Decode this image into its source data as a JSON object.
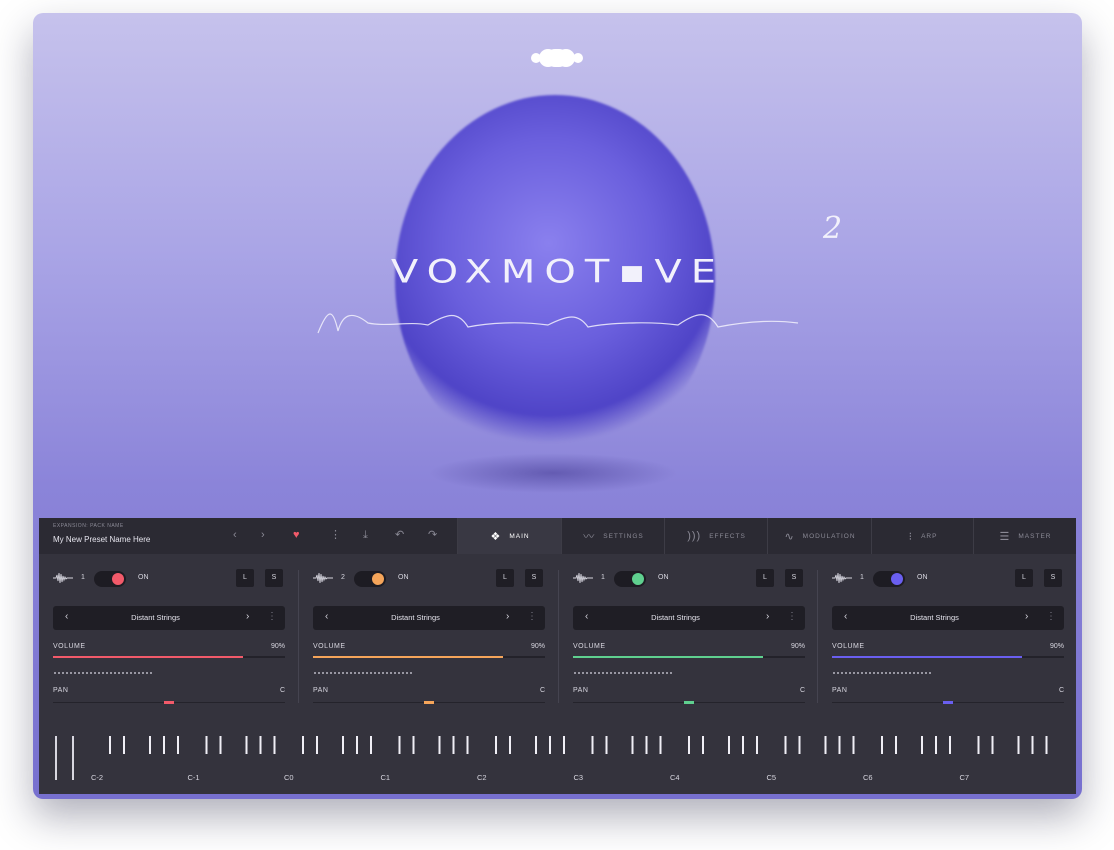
{
  "hero": {
    "product_title": "VOXMOT▪VE",
    "version_mark": "2",
    "subtitle_script": "New Age Cinematic Vocals"
  },
  "colors": {
    "accent_red": "#f25a6a",
    "accent_orange": "#f5a55a",
    "accent_green": "#5fd08f",
    "accent_blue": "#6a5ff0",
    "panel_bg": "#34333d"
  },
  "topbar": {
    "expansion_label": "EXPANSION: PACK NAME",
    "preset_name": "My New Preset  Name Here",
    "icons": [
      "chevron-left-icon",
      "chevron-right-icon",
      "heart-icon",
      "kebab-icon",
      "download-icon",
      "undo-icon",
      "redo-icon"
    ],
    "tabs": [
      {
        "label": "MAIN",
        "icon": "main-diamond-icon",
        "active": true
      },
      {
        "label": "SETTINGS",
        "icon": "waveform-icon",
        "active": false
      },
      {
        "label": "EFFECTS",
        "icon": "effects-icon",
        "active": false
      },
      {
        "label": "MODULATION",
        "icon": "modulation-icon",
        "active": false
      },
      {
        "label": "ARP",
        "icon": "arp-icon",
        "active": false
      },
      {
        "label": "MASTER",
        "icon": "sliders-icon",
        "active": false
      }
    ]
  },
  "channels": [
    {
      "number": "1",
      "on_label": "ON",
      "l_label": "L",
      "s_label": "S",
      "sample": "Distant Strings",
      "volume_label": "VOLUME",
      "volume_value": "90%",
      "volume_fraction": 0.82,
      "pan_label": "PAN",
      "pan_value": "C",
      "color": "#f25a6a"
    },
    {
      "number": "2",
      "on_label": "ON",
      "l_label": "L",
      "s_label": "S",
      "sample": "Distant Strings",
      "volume_label": "VOLUME",
      "volume_value": "90%",
      "volume_fraction": 0.82,
      "pan_label": "PAN",
      "pan_value": "C",
      "color": "#f5a55a"
    },
    {
      "number": "1",
      "on_label": "ON",
      "l_label": "L",
      "s_label": "S",
      "sample": "Distant Strings",
      "volume_label": "VOLUME",
      "volume_value": "90%",
      "volume_fraction": 0.82,
      "pan_label": "PAN",
      "pan_value": "C",
      "color": "#5fd08f"
    },
    {
      "number": "1",
      "on_label": "ON",
      "l_label": "L",
      "s_label": "S",
      "sample": "Distant Strings",
      "volume_label": "VOLUME",
      "volume_value": "90%",
      "volume_fraction": 0.82,
      "pan_label": "PAN",
      "pan_value": "C",
      "color": "#6a5ff0"
    }
  ],
  "keyboard": {
    "octave_labels": [
      "C-2",
      "C-1",
      "C0",
      "C1",
      "C2",
      "C3",
      "C4",
      "C5",
      "C6",
      "C7"
    ]
  }
}
